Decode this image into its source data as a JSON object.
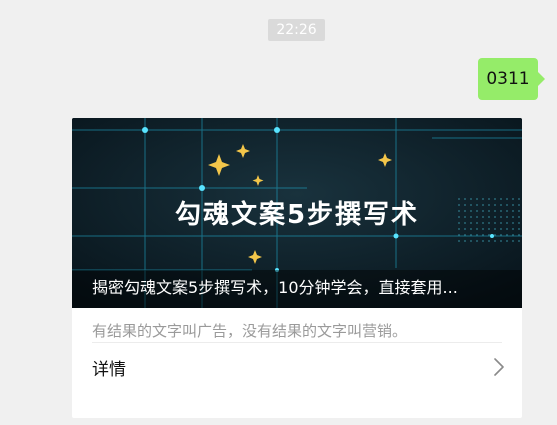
{
  "timestamp": "22:26",
  "outgoing_message": "0311",
  "article": {
    "cover_title": "勾魂文案5步撰写术",
    "cover_caption": "揭密勾魂文案5步撰写术，10分钟学会，直接套用...",
    "summary": "有结果的文字叫广告，没有结果的文字叫营销。",
    "details_label": "详情",
    "chevron_icon": "chevron-right-icon",
    "colors": {
      "outgoing_bubble": "#95ec69",
      "cover_background": "#0d1b23",
      "grid_lines": "#1fa8c8",
      "sparkles": "#f3c64a"
    }
  }
}
